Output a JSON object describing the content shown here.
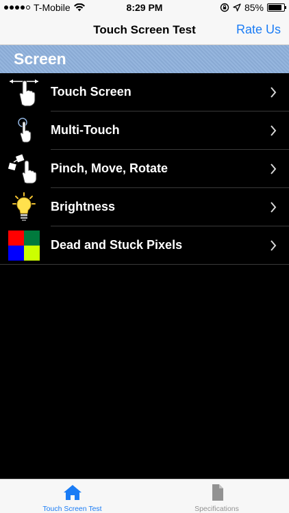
{
  "status_bar": {
    "carrier": "T-Mobile",
    "time": "8:29 PM",
    "battery": "85%",
    "battery_level": 0.85
  },
  "nav": {
    "title": "Touch Screen Test",
    "action_label": "Rate Us"
  },
  "section": {
    "title": "Screen"
  },
  "items": [
    {
      "label": "Touch Screen",
      "icon": "swipe-hand-icon"
    },
    {
      "label": "Multi-Touch",
      "icon": "pointing-hand-icon"
    },
    {
      "label": "Pinch, Move, Rotate",
      "icon": "pinch-hand-icon"
    },
    {
      "label": "Brightness",
      "icon": "lightbulb-icon"
    },
    {
      "label": "Dead and Stuck Pixels",
      "icon": "color-pixels-icon"
    }
  ],
  "pixel_colors": [
    "#ff0000",
    "#007a3d",
    "#0000ff",
    "#ccff00"
  ],
  "tabs": [
    {
      "label": "Touch Screen Test",
      "icon": "home-icon",
      "active": true
    },
    {
      "label": "Specifications",
      "icon": "document-icon",
      "active": false
    }
  ],
  "colors": {
    "accent": "#1a7cf5",
    "section_bg": "#8fb1dc",
    "list_bg": "#000000"
  }
}
